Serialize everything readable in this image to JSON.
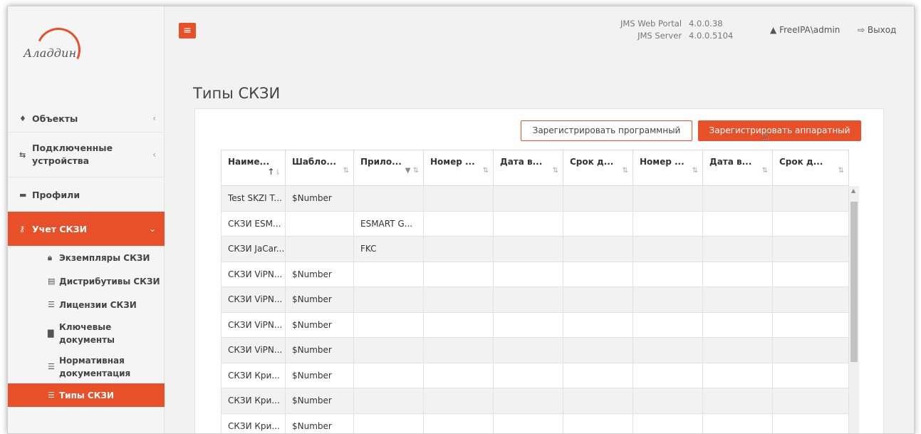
{
  "brand": {
    "logo_text": "Аладдин",
    "accent_color": "#e8502a"
  },
  "header": {
    "menu_icon": "hamburger-icon",
    "portal_label": "JMS Web Portal",
    "portal_version": "4.0.0.38",
    "server_label": "JMS Server",
    "server_version": "4.0.0.5104",
    "user": "FreeIPA\\admin",
    "logout": "Выход"
  },
  "sidebar": {
    "items": [
      {
        "label": "Объекты",
        "icon": "diamond-icon"
      },
      {
        "label": "Подключенные устройства",
        "icon": "usb-icon"
      },
      {
        "label": "Профили",
        "icon": "folder-icon"
      },
      {
        "label": "Учет СКЗИ",
        "icon": "key-icon"
      }
    ],
    "sub_items": [
      {
        "label": "Экземпляры СКЗИ",
        "icon": "lock-icon"
      },
      {
        "label": "Дистрибутивы СКЗИ",
        "icon": "file-icon"
      },
      {
        "label": "Лицензии СКЗИ",
        "icon": "list-icon"
      },
      {
        "label": "Ключевые документы",
        "icon": "document-icon"
      },
      {
        "label": "Нормативная документация",
        "icon": "list-icon"
      },
      {
        "label": "Типы СКЗИ",
        "icon": "list-icon"
      }
    ]
  },
  "main": {
    "title": "Типы СКЗИ",
    "btn_register_soft": "Зарегистрировать программный",
    "btn_register_hw": "Зарегистрировать аппаратный",
    "columns": [
      "Наиме...",
      "Шабло...",
      "Прило...",
      "Номер ...",
      "Дата в...",
      "Срок д...",
      "Номер ...",
      "Дата в...",
      "Срок д..."
    ],
    "rows": [
      [
        "Test SKZI T...",
        "$Number",
        "",
        "",
        "",
        "",
        "",
        "",
        ""
      ],
      [
        "СКЗИ ESM...",
        "",
        "ESMART G...",
        "",
        "",
        "",
        "",
        "",
        ""
      ],
      [
        "СКЗИ JaCar...",
        "",
        "FKC",
        "",
        "",
        "",
        "",
        "",
        ""
      ],
      [
        "СКЗИ ViPN...",
        "$Number",
        "",
        "",
        "",
        "",
        "",
        "",
        ""
      ],
      [
        "СКЗИ ViPN...",
        "$Number",
        "",
        "",
        "",
        "",
        "",
        "",
        ""
      ],
      [
        "СКЗИ ViPN...",
        "$Number",
        "",
        "",
        "",
        "",
        "",
        "",
        ""
      ],
      [
        "СКЗИ ViPN...",
        "$Number",
        "",
        "",
        "",
        "",
        "",
        "",
        ""
      ],
      [
        "СКЗИ Кри...",
        "$Number",
        "",
        "",
        "",
        "",
        "",
        "",
        ""
      ],
      [
        "СКЗИ Кри...",
        "$Number",
        "",
        "",
        "",
        "",
        "",
        "",
        ""
      ],
      [
        "СКЗИ Кри...",
        "$Number",
        "",
        "",
        "",
        "",
        "",
        "",
        ""
      ]
    ]
  }
}
